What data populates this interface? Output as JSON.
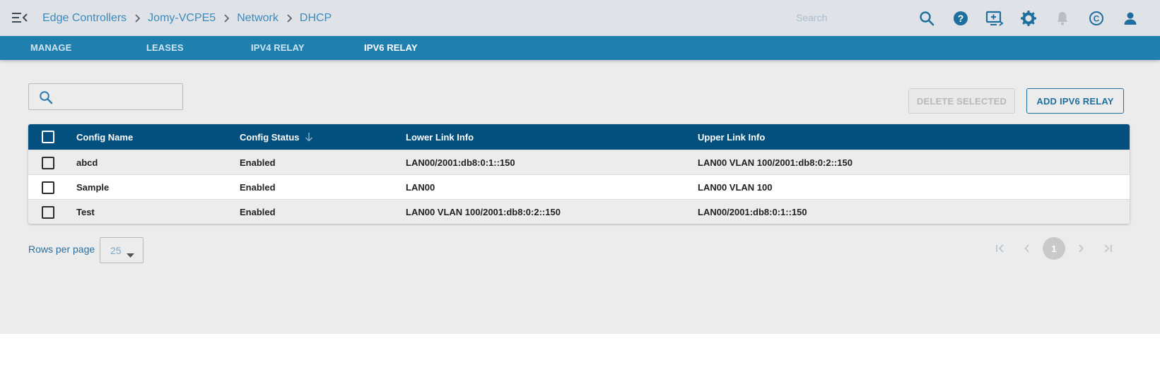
{
  "header": {
    "breadcrumb": [
      "Edge Controllers",
      "Jomy-VCPE5",
      "Network",
      "DHCP"
    ],
    "search_placeholder": "Search",
    "icons": [
      "search-icon",
      "help-icon",
      "add-screen-icon",
      "gear-icon",
      "bell-icon",
      "copyright-icon",
      "user-icon"
    ]
  },
  "tabs": [
    "MANAGE",
    "LEASES",
    "IPV4 RELAY",
    "IPV6 RELAY"
  ],
  "active_tab": "IPV6 RELAY",
  "toolbar": {
    "delete_label": "DELETE SELECTED",
    "add_label": "ADD IPV6 RELAY"
  },
  "table": {
    "columns": {
      "name": "Config Name",
      "status": "Config Status",
      "lower": "Lower Link Info",
      "upper": "Upper Link Info"
    },
    "sort": {
      "column": "Config Status",
      "direction": "descending"
    },
    "rows": [
      {
        "name": "abcd",
        "status": "Enabled",
        "lower": "LAN00/2001:db8:0:1::150",
        "upper": "LAN00 VLAN 100/2001:db8:0:2::150"
      },
      {
        "name": "Sample",
        "status": "Enabled",
        "lower": "LAN00",
        "upper": "LAN00 VLAN 100"
      },
      {
        "name": "Test",
        "status": "Enabled",
        "lower": "LAN00 VLAN 100/2001:db8:0:2::150",
        "upper": "LAN00/2001:db8:0:1::150"
      }
    ]
  },
  "pagination": {
    "rows_per_page_label": "Rows per page",
    "rows_per_page": "25",
    "current_page": "1"
  },
  "colors": {
    "header_bg": "#dfe3e7",
    "tabbar_bg": "#1f80b0",
    "table_header_bg": "#034f7d",
    "accent": "#1f6f9e",
    "link": "#3b8bbf"
  }
}
